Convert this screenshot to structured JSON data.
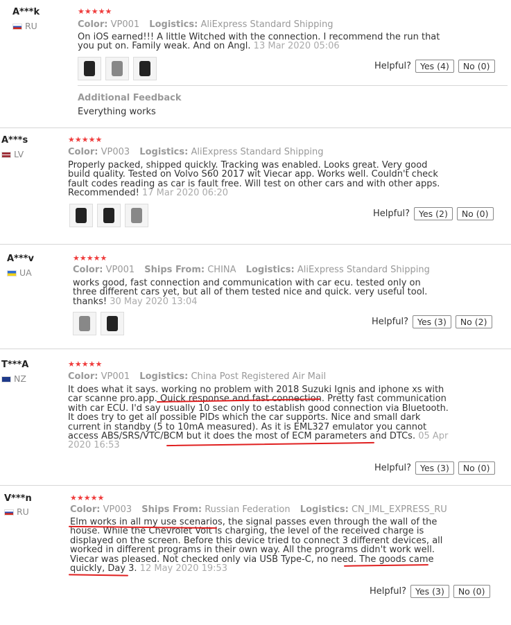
{
  "labels": {
    "color": "Color:",
    "logistics": "Logistics:",
    "ships_from": "Ships From:",
    "helpful": "Helpful?"
  },
  "reviews": [
    {
      "user": "A***k",
      "country": "RU",
      "stars": "★★★★★",
      "color": "VP001",
      "logistics": "AliExpress Standard Shipping",
      "text": "On iOS earned!!! A little Witched with the connection. I recommend the run that you put on. Family weak. And on Angl.",
      "date": "13 Mar 2020 05:06",
      "yes": "Yes (4)",
      "no": "No (0)",
      "additional_title": "Additional Feedback",
      "additional_text": "Everything works"
    },
    {
      "user": "A***s",
      "country": "LV",
      "stars": "★★★★★",
      "color": "VP003",
      "logistics": "AliExpress Standard Shipping",
      "text": "Properly packed, shipped quickly. Tracking was enabled. Looks great. Very good build quality. Tested on Volvo S60 2017 wit Viecar app. Works well. Couldn't check fault codes reading as car is fault free. Will test on other cars and with other apps. Recommended!",
      "date": "17 Mar 2020 06:20",
      "yes": "Yes (2)",
      "no": "No (0)"
    },
    {
      "user": "A***v",
      "country": "UA",
      "stars": "★★★★★",
      "color": "VP001",
      "ships_from": "CHINA",
      "logistics": "AliExpress Standard Shipping",
      "text": "works good, fast connection and communication with car ecu. tested only on three different cars yet, but all of them tested nice and quick. very useful tool. thanks!",
      "date": "30 May 2020 13:04",
      "yes": "Yes (3)",
      "no": "No (2)"
    },
    {
      "user": "T***A",
      "country": "NZ",
      "stars": "★★★★★",
      "color": "VP001",
      "logistics": "China Post Registered Air Mail",
      "text": "It does what it says. working no problem with 2018 Suzuki Ignis and iphone xs with car scanne pro.app. Quick response and fast connection. Pretty fast communication with car ECU. I'd say usually 10 sec only to establish good connection via Bluetooth. It does try to get all possible PIDs which the car supports. Nice and small dark current in standby (5 to 10mA measured). As it is EML327 emulator you cannot access ABS/SRS/VTC/BCM but it does the most of ECM parameters and DTCs.",
      "date": "05 Apr 2020 16:53",
      "yes": "Yes (3)",
      "no": "No (0)"
    },
    {
      "user": "V***n",
      "country": "RU",
      "stars": "★★★★★",
      "color": "VP003",
      "ships_from": "Russian Federation",
      "logistics": "CN_IML_EXPRESS_RU",
      "text": "Elm works in all my use scenarios, the signal passes even through the wall of the house. While the Chevrolet Volt is charging, the level of the received charge is displayed on the screen. Before this device tried to connect 3 different devices, all worked in different programs in their own way. All the programs didn't work well. Viecar was pleased. Not checked only via USB Type-C, no need. The goods came quickly, Day 3.",
      "date": "12 May 2020 19:53",
      "yes": "Yes (3)",
      "no": "No (0)"
    }
  ],
  "colors": {
    "star": "#ef3c3c",
    "underline": "#e02020",
    "muted": "#999999"
  }
}
